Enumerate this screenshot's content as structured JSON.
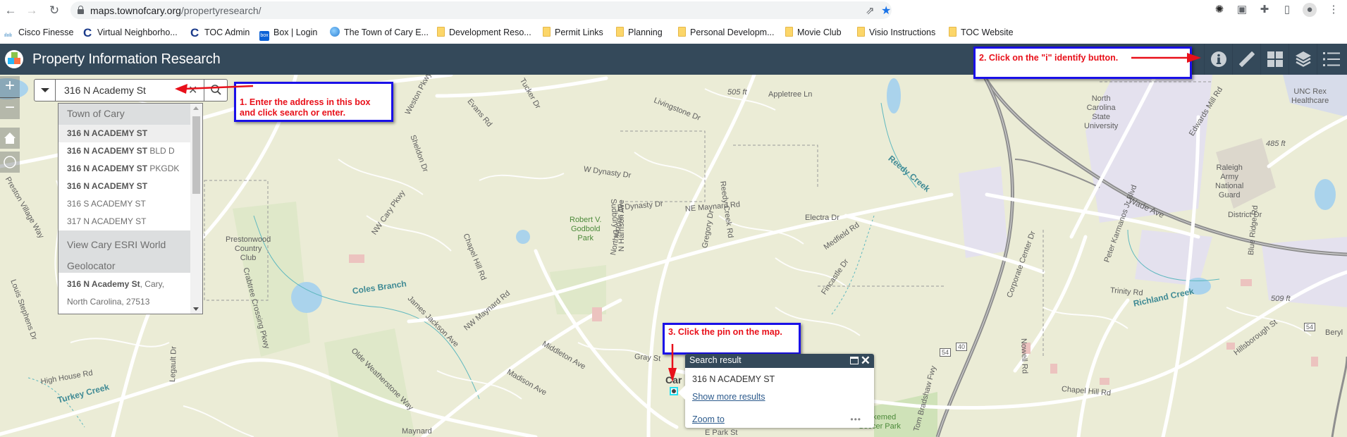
{
  "browser": {
    "url_domain": "maps.townofcary.org",
    "url_path": "/propertyresearch/",
    "bookmarks": [
      {
        "label": "Cisco Finesse",
        "icon": "cisco-icon"
      },
      {
        "label": "Virtual Neighborho...",
        "icon": "c-icon"
      },
      {
        "label": "TOC Admin",
        "icon": "c-icon"
      },
      {
        "label": "Box | Login",
        "icon": "box-icon"
      },
      {
        "label": "The Town of Cary E...",
        "icon": "globe-icon"
      },
      {
        "label": "Development Reso...",
        "icon": "folder-icon"
      },
      {
        "label": "Permit Links",
        "icon": "folder-icon"
      },
      {
        "label": "Planning",
        "icon": "folder-icon"
      },
      {
        "label": "Personal Developm...",
        "icon": "folder-icon"
      },
      {
        "label": "Movie Club",
        "icon": "folder-icon"
      },
      {
        "label": "Visio Instructions",
        "icon": "folder-icon"
      },
      {
        "label": "TOC Website",
        "icon": "folder-icon"
      }
    ]
  },
  "app": {
    "title": "Property Information Research",
    "header_color": "#34495a",
    "toolbar": [
      {
        "name": "identify",
        "icon": "info-icon"
      },
      {
        "name": "measure",
        "icon": "ruler-icon"
      },
      {
        "name": "basemap-gallery",
        "icon": "grid-icon"
      },
      {
        "name": "layers",
        "icon": "layers-icon"
      },
      {
        "name": "legend",
        "icon": "list-icon"
      }
    ]
  },
  "search": {
    "value": "316 N Academy St",
    "clear_glyph": "✕",
    "suggestions": {
      "group1_title": "Town of Cary",
      "group1_items": [
        {
          "bold": "316 N ACADEMY ST",
          "rest": ""
        },
        {
          "bold": "316 N ACADEMY ST",
          "rest": " BLD D"
        },
        {
          "bold": "316 N ACADEMY ST",
          "rest": " PKGDK"
        },
        {
          "bold": "316 N ACADEMY ST",
          "rest": ""
        },
        {
          "bold": "",
          "rest": "316 S ACADEMY ST"
        },
        {
          "bold": "",
          "rest": "317 N ACADEMY ST"
        }
      ],
      "group2_title_line1": "View Cary ESRI World",
      "group2_title_line2": "Geolocator",
      "group2_item_bold": "316 N Academy St",
      "group2_item_rest": ", Cary,",
      "group2_item_line2": "North Carolina, 27513"
    }
  },
  "annotations": {
    "step1_line1": "1. Enter the address in this box",
    "step1_line2": "and click search or enter.",
    "step2": "2. Click on the \"i\" identify button.",
    "step3": "3.  Click the pin on the map.",
    "text_color": "#e8101a",
    "border_color": "#1a10e8"
  },
  "popup": {
    "title": "Search result",
    "address": "316 N ACADEMY ST",
    "show_more": "Show more results",
    "zoom_to": "Zoom to",
    "more_glyph": "•••"
  },
  "map": {
    "pin_label": "Car",
    "labels": {
      "weston_pkwy": "Weston Pkwy",
      "sheldon_dr": "Sheldon Dr",
      "evans_rd": "Evans Rd",
      "tucker_dr": "Tucker Dr",
      "livingstone_dr": "Livingstone Dr",
      "elev_505": "505 ft",
      "appletree_ln": "Appletree Ln",
      "w_dynasty_dr": "W Dynasty Dr",
      "reedy_creek_rd": "Reedy Creek Rd",
      "reedy_creek": "Reedy Creek",
      "e_dynasty_dr": "E Dynasty Dr",
      "sudbury_dr": "Sudbury Dr",
      "electra_dr": "Electra Dr",
      "nw_cary_pkwy": "NW Cary Pkwy",
      "prestonwood": "Prestonwood\nCountry\nClub",
      "crabtree": "Crabtree Crossing Pkwy",
      "coles_branch": "Coles Branch",
      "chapel_hill_rd_w": "Chapel Hill Rd",
      "james_jackson": "James Jackson Ave",
      "nw_maynard": "NW Maynard Rd",
      "godbold": "Robert V.\nGodbold\nPark",
      "ne_maynard": "NE Maynard Rd",
      "northwoods": "Northwoods Dr",
      "n_harrison": "N Harrison Ave",
      "gregory_dr": "Gregory Dr",
      "medfield_rd": "Medfield Rd",
      "fincastle_dr": "Fincastle Dr",
      "middleton": "Middleton Ave",
      "madison": "Madison Ave",
      "gray_st": "Gray St",
      "e_park_st": "E Park St",
      "olde_weatherstone": "Olde Weatherstone Way",
      "high_house_rd": "High House Rd",
      "turkey_creek": "Turkey Creek",
      "legault_dr": "Legault Dr",
      "louis_stephens": "Louis Stephens Dr",
      "preston_village": "Preston Village Way",
      "maynard": "Maynard",
      "ncsu": "North\nCarolina\nState\nUniversity",
      "unc_rex": "UNC Rex\nHealthcare",
      "edwards_mill": "Edwards Mill Rd",
      "elev_485": "485 ft",
      "raleigh_guard": "Raleigh\nArmy\nNational\nGuard",
      "district_dr": "District Dr",
      "wade_ave": "Wade Ave",
      "peter_karmanos": "Peter Karmanos Jr Blvd",
      "trinity_rd": "Trinity Rd",
      "richland_creek": "Richland Creek",
      "blue_ridge": "Blue Ridge Rd",
      "elev_509": "509 ft",
      "corporate_center": "Corporate Center Dr",
      "nowell_rd": "Nowell Rd",
      "chapel_hill_rd_e": "Chapel Hill Rd",
      "hillsborough": "Hillsborough St",
      "beryl": "Beryl",
      "tom_bradshaw": "Tom Bradshaw Fwy",
      "soccer_park": "Bakemed\nSoccer Park",
      "i40": "40",
      "nc54": "54"
    }
  }
}
